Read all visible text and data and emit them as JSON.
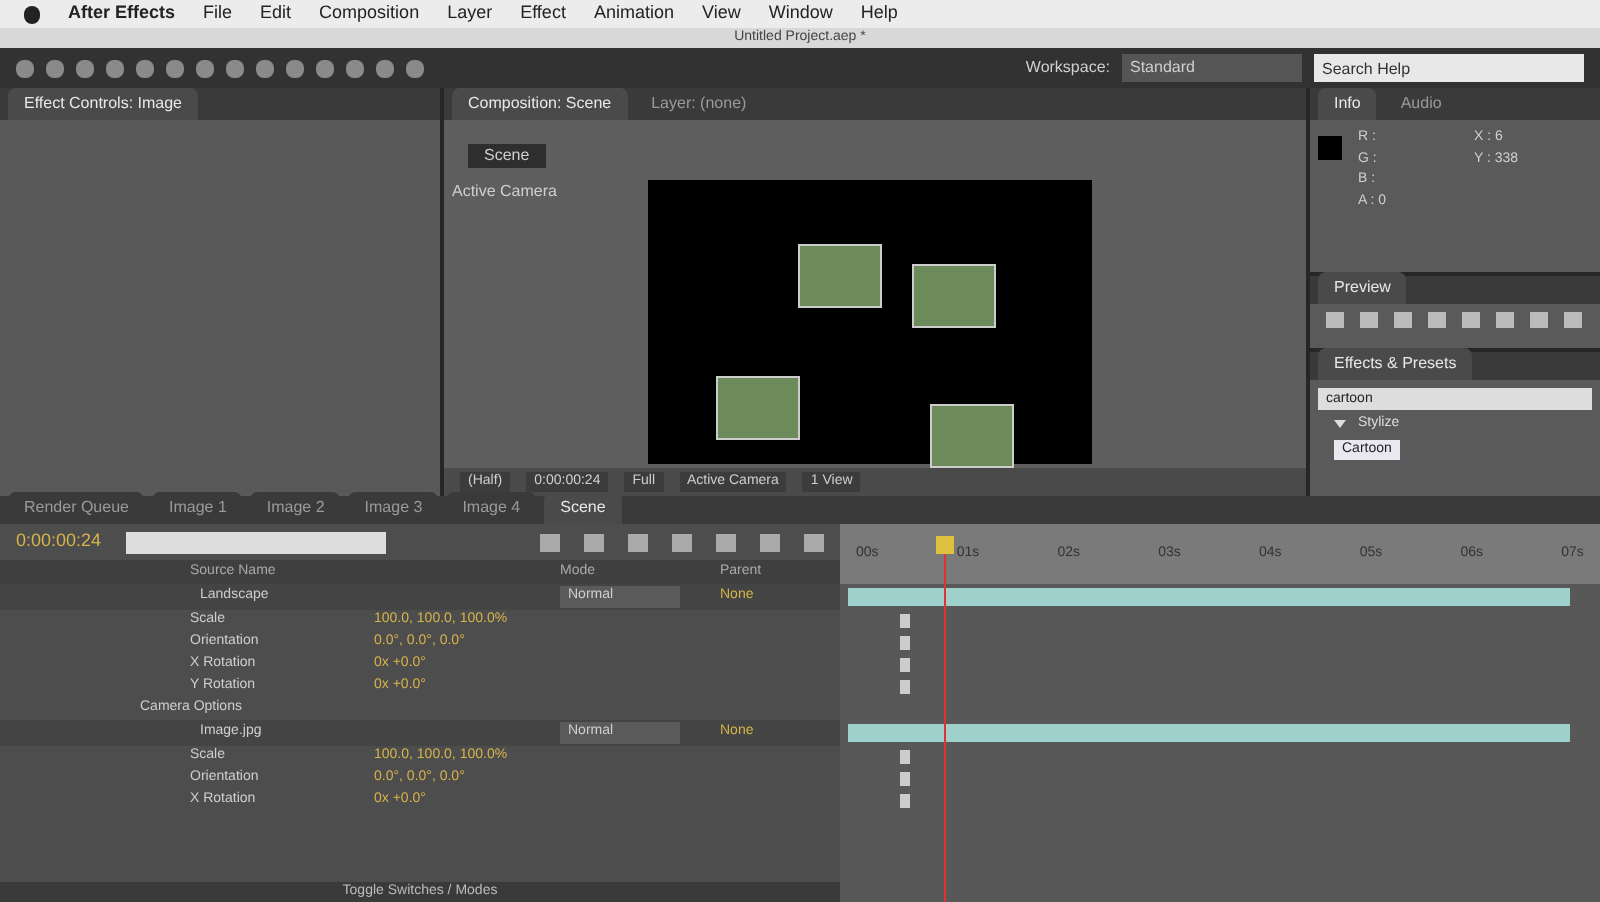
{
  "menu_bar": [
    "After Effects",
    "File",
    "Edit",
    "Composition",
    "Layer",
    "Effect",
    "Animation",
    "View",
    "Window",
    "Help"
  ],
  "title_bar": {
    "title": "Untitled Project.aep *"
  },
  "toolbar": {
    "workspace_label": "Workspace:",
    "workspace_value": "Standard",
    "search_placeholder": "Search Help"
  },
  "project_panel": {
    "tab": "Effect Controls: Image"
  },
  "composition_panel": {
    "tab": "Composition: Scene",
    "tab_2": "Layer: (none)",
    "comp_button": "Scene",
    "view_label": "Active Camera",
    "footer": [
      "(Half)",
      "0:00:00:24",
      "Full",
      "Active Camera",
      "1 View"
    ]
  },
  "info_panel": {
    "tabs": [
      {
        "label": "Info",
        "selected": true
      },
      {
        "label": "Audio",
        "selected": false
      }
    ],
    "rgb": [
      "R :",
      "G :",
      "B :",
      "A : 0"
    ],
    "xy": [
      "X : 6",
      "Y : 338"
    ]
  },
  "preview_panel": {
    "tab": "Preview"
  },
  "effects_panel": {
    "tab": "Effects & Presets",
    "search_value": "cartoon",
    "items": [
      {
        "label": "Stylize",
        "expanded": true
      },
      {
        "label": "Cartoon",
        "selected": true
      }
    ]
  },
  "timeline": {
    "tabs": [
      {
        "label": "Render Queue",
        "selected": false
      },
      {
        "label": "Image 1",
        "selected": false
      },
      {
        "label": "Image 2",
        "selected": false
      },
      {
        "label": "Image 3",
        "selected": false
      },
      {
        "label": "Image 4",
        "selected": false
      },
      {
        "label": "Scene",
        "selected": true
      }
    ],
    "timecode": "0:00:00:24",
    "columns": [
      "Source Name",
      "Mode",
      "Parent"
    ],
    "rows": [
      {
        "kind": "layer",
        "name": "Landscape",
        "mode": "Normal",
        "parent": "None"
      },
      {
        "kind": "property",
        "name": "Scale",
        "value": "100.0, 100.0, 100.0%"
      },
      {
        "kind": "property",
        "name": "Orientation",
        "value": "0.0°, 0.0°, 0.0°"
      },
      {
        "kind": "property",
        "name": "X Rotation",
        "value": "0x +0.0°"
      },
      {
        "kind": "property",
        "name": "Y Rotation",
        "value": "0x +0.0°"
      },
      {
        "kind": "group",
        "name": "Camera Options"
      },
      {
        "kind": "layer",
        "name": "Image.jpg",
        "mode": "Normal",
        "parent": "None"
      },
      {
        "kind": "property",
        "name": "Scale",
        "value": "100.0, 100.0, 100.0%"
      },
      {
        "kind": "property",
        "name": "Orientation",
        "value": "0.0°, 0.0°, 0.0°"
      },
      {
        "kind": "property",
        "name": "X Rotation",
        "value": "0x +0.0°"
      }
    ],
    "ruler": [
      "00s",
      "01s",
      "02s",
      "03s",
      "04s",
      "05s",
      "06s",
      "07s"
    ],
    "footer": "Toggle Switches / Modes"
  }
}
